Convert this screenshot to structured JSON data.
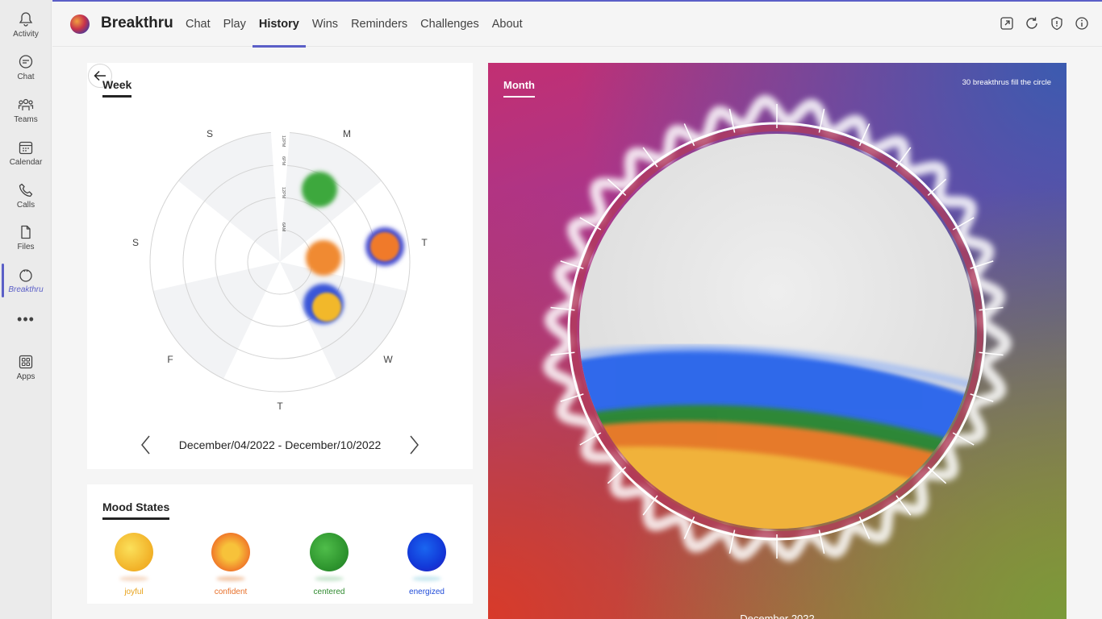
{
  "rail": {
    "items": [
      {
        "label": "Activity"
      },
      {
        "label": "Chat"
      },
      {
        "label": "Teams"
      },
      {
        "label": "Calendar"
      },
      {
        "label": "Calls"
      },
      {
        "label": "Files"
      },
      {
        "label": "Breakthru"
      },
      {
        "label": "Apps"
      }
    ],
    "more": "•••"
  },
  "header": {
    "app_title": "Breakthru",
    "tabs": [
      {
        "label": "Chat"
      },
      {
        "label": "Play"
      },
      {
        "label": "History"
      },
      {
        "label": "Wins"
      },
      {
        "label": "Reminders"
      },
      {
        "label": "Challenges"
      },
      {
        "label": "About"
      }
    ],
    "active_tab": "History",
    "icons": [
      "popout-icon",
      "refresh-icon",
      "shield-icon",
      "info-icon"
    ]
  },
  "week": {
    "title": "Week",
    "days": [
      "S",
      "M",
      "T",
      "W",
      "T",
      "F",
      "S"
    ],
    "time_labels": [
      "12PM",
      "6PM",
      "12PM",
      "6AM"
    ],
    "range": "December/04/2022 - December/10/2022",
    "entries": [
      {
        "day": "M",
        "mood": "centered"
      },
      {
        "day": "T",
        "mood": "confident"
      },
      {
        "day": "T",
        "mood": "energized"
      },
      {
        "day": "W",
        "mood": "confident"
      },
      {
        "day": "W",
        "mood": "joyful"
      }
    ]
  },
  "mood_states": {
    "title": "Mood States",
    "items": [
      {
        "label": "joyful",
        "color": "#f2b32a"
      },
      {
        "label": "confident",
        "color": "#f07a2a"
      },
      {
        "label": "centered",
        "color": "#2fa02f"
      },
      {
        "label": "energized",
        "color": "#1f4bd8"
      }
    ]
  },
  "month": {
    "title": "Month",
    "note": "30 breakthrus fill the circle",
    "footer": "December 2022",
    "fill_bands": [
      {
        "mood": "energized",
        "color": "#2563eb"
      },
      {
        "mood": "centered",
        "color": "#2f8a2f"
      },
      {
        "mood": "confident",
        "color": "#f07a2a"
      },
      {
        "mood": "joyful",
        "color": "#f0b23a"
      }
    ]
  },
  "colors": {
    "accent": "#5b5fc7"
  }
}
